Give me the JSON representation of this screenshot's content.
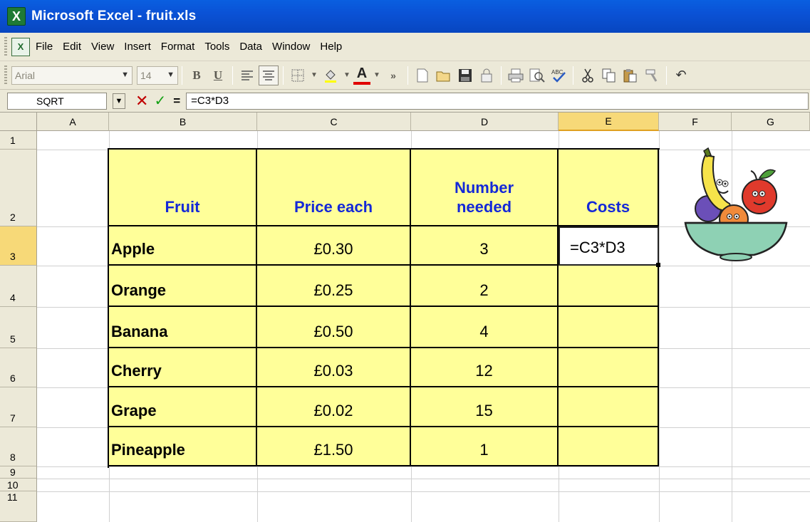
{
  "window": {
    "title": "Microsoft Excel - fruit.xls"
  },
  "menu": [
    "File",
    "Edit",
    "View",
    "Insert",
    "Format",
    "Tools",
    "Data",
    "Window",
    "Help"
  ],
  "toolbar": {
    "font": "Arial",
    "size": "14",
    "bold": "B",
    "underline": "U"
  },
  "formula_bar": {
    "name_box": "SQRT",
    "formula": "=C3*D3",
    "equals": "="
  },
  "columns": [
    "A",
    "B",
    "C",
    "D",
    "E",
    "F",
    "G"
  ],
  "rows": [
    "1",
    "2",
    "3",
    "4",
    "5",
    "6",
    "7",
    "8",
    "9",
    "10",
    "11"
  ],
  "table": {
    "headers": {
      "fruit": "Fruit",
      "price": "Price each",
      "number": "Number needed",
      "costs": "Costs"
    },
    "rows": [
      {
        "fruit": "Apple",
        "price": "£0.30",
        "number": "3",
        "cost": "=C3*D3"
      },
      {
        "fruit": "Orange",
        "price": "£0.25",
        "number": "2",
        "cost": ""
      },
      {
        "fruit": "Banana",
        "price": "£0.50",
        "number": "4",
        "cost": ""
      },
      {
        "fruit": "Cherry",
        "price": "£0.03",
        "number": "12",
        "cost": ""
      },
      {
        "fruit": "Grape",
        "price": "£0.02",
        "number": "15",
        "cost": ""
      },
      {
        "fruit": "Pineapple",
        "price": "£1.50",
        "number": "1",
        "cost": ""
      }
    ]
  },
  "active_cell": {
    "column": "E",
    "row": "3"
  },
  "colors": {
    "cell_fill": "#ffff99",
    "header_text": "#1428d8",
    "title_bar": "#0a52d6"
  }
}
